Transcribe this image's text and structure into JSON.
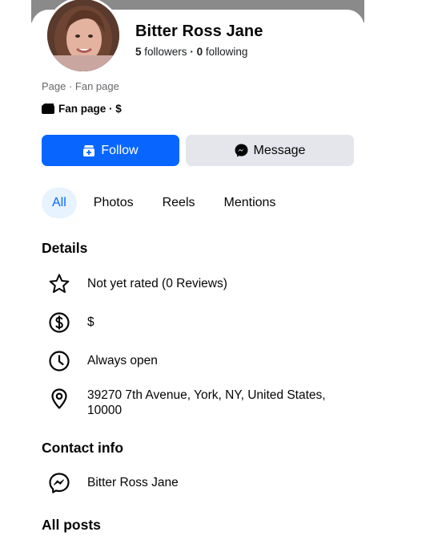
{
  "profile": {
    "name": "Bitter Ross Jane",
    "followers_count": "5",
    "followers_label": "followers",
    "separator": "·",
    "following_count": "0",
    "following_label": "following",
    "page_type": "Page · Fan page",
    "category": "Fan page · $"
  },
  "actions": {
    "follow_label": "Follow",
    "message_label": "Message"
  },
  "tabs": [
    {
      "label": "All",
      "active": true
    },
    {
      "label": "Photos",
      "active": false
    },
    {
      "label": "Reels",
      "active": false
    },
    {
      "label": "Mentions",
      "active": false
    }
  ],
  "details": {
    "title": "Details",
    "items": [
      {
        "icon": "star-icon",
        "text": "Not yet rated (0 Reviews)"
      },
      {
        "icon": "dollar-icon",
        "text": "$"
      },
      {
        "icon": "clock-icon",
        "text": "Always open"
      },
      {
        "icon": "location-pin-icon",
        "text_line1": "39270 7th Avenue, York, NY, United States,",
        "text_line2": "10000"
      }
    ]
  },
  "contact": {
    "title": "Contact info",
    "messenger_name": "Bitter Ross Jane"
  },
  "posts": {
    "title": "All posts"
  },
  "colors": {
    "brand_blue": "#0866ff",
    "secondary_button": "#e4e6eb",
    "active_tab_bg": "#e7f3ff",
    "muted_text": "#65676b"
  }
}
